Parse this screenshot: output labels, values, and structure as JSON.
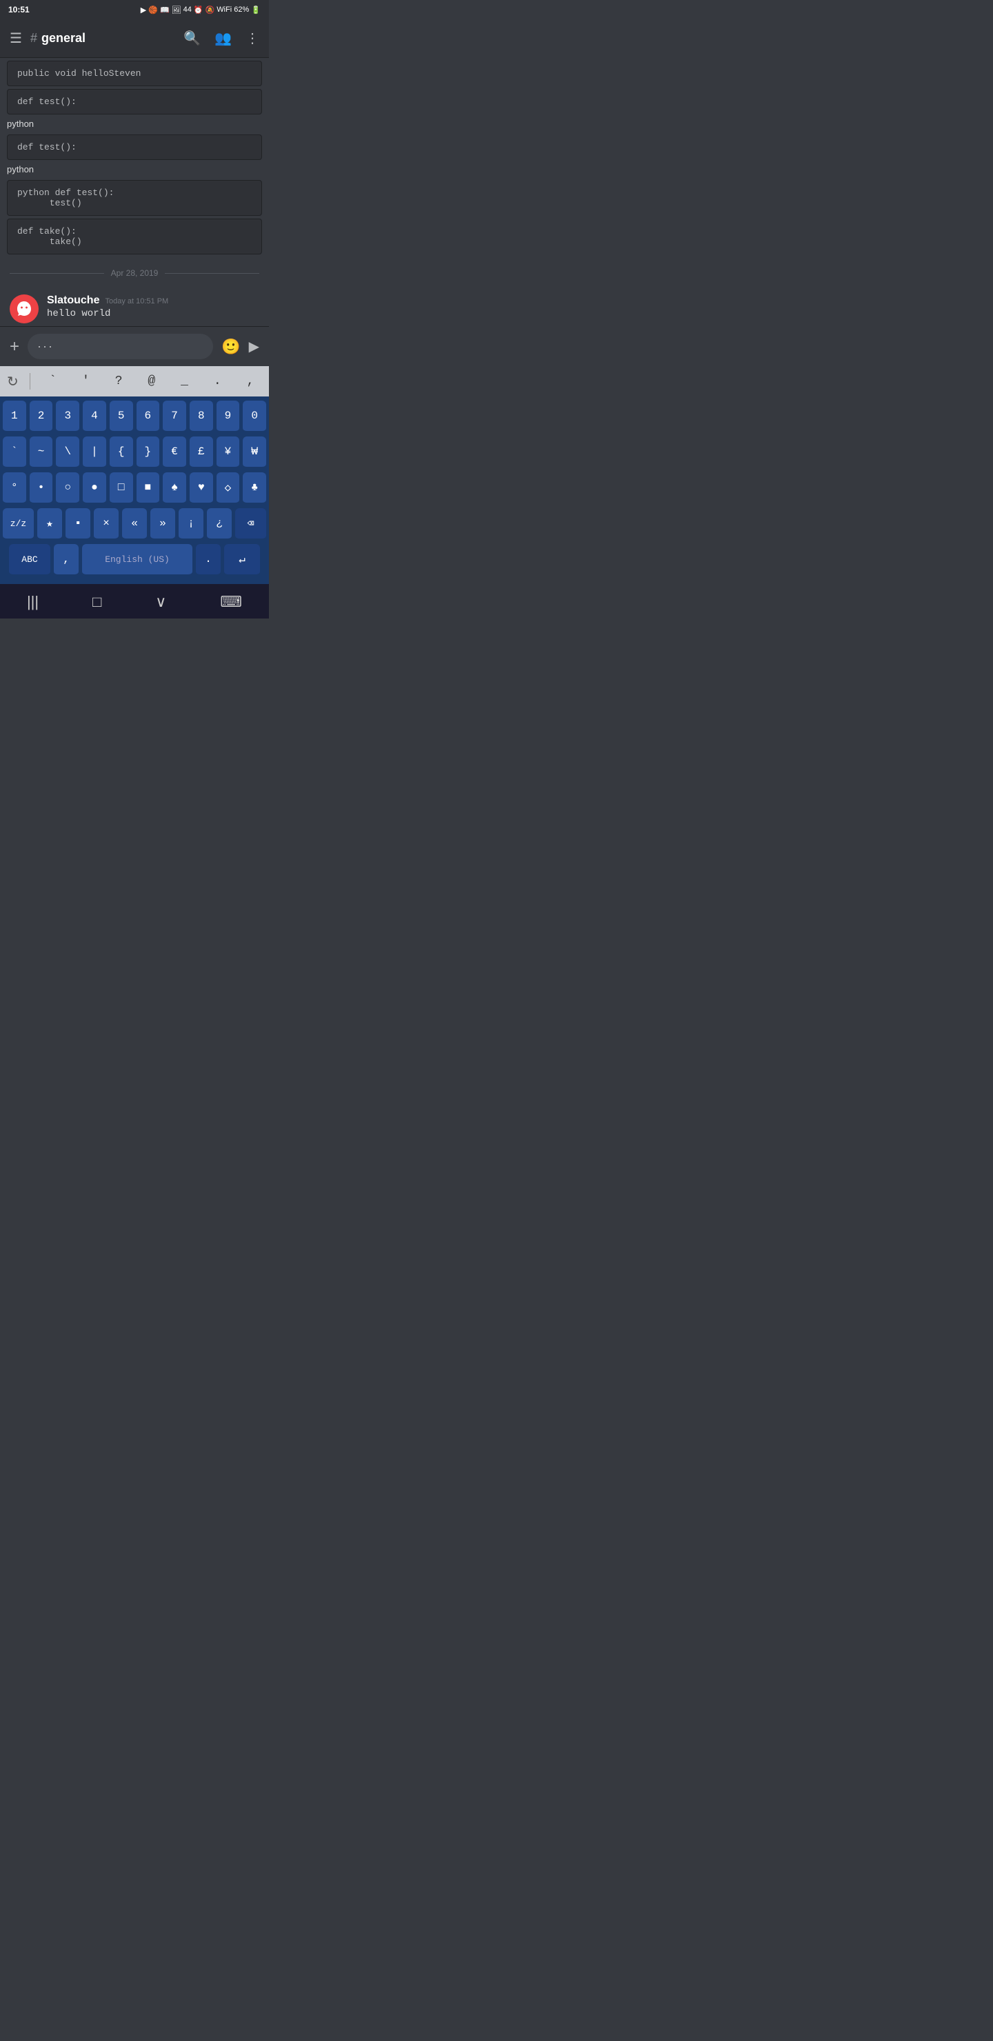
{
  "statusBar": {
    "time": "10:51",
    "battery": "62%",
    "signal": "44"
  },
  "header": {
    "channelName": "general",
    "hashSymbol": "#"
  },
  "codeBlocks": [
    {
      "id": 1,
      "code": "public void helloSteven"
    },
    {
      "id": 2,
      "code": "def test():"
    },
    {
      "id": 3,
      "lang": "python"
    },
    {
      "id": 4,
      "code": "def test():"
    },
    {
      "id": 5,
      "lang": "python"
    },
    {
      "id": 6,
      "code": "python def test():\n      test()"
    },
    {
      "id": 7,
      "code": "def take():\n      take()"
    }
  ],
  "dateSeparator": "Apr 28, 2019",
  "message": {
    "author": "Slatouche",
    "time": "Today at 10:51 PM",
    "text": "hello world"
  },
  "inputBar": {
    "placeholder": "···"
  },
  "toolbar": {
    "keys": [
      "`",
      "'",
      "?",
      "@",
      "_",
      ".",
      ","
    ]
  },
  "keyboard": {
    "rows": [
      [
        "1",
        "2",
        "3",
        "4",
        "5",
        "6",
        "7",
        "8",
        "9",
        "0"
      ],
      [
        "`",
        "~",
        "\\",
        "|",
        "{",
        "}",
        "€",
        "£",
        "¥",
        "₩"
      ],
      [
        "°",
        "•",
        "○",
        "●",
        "□",
        "■",
        "♠",
        "♥",
        "◇",
        "♣"
      ],
      [
        "z/z",
        "★",
        "▪",
        "×",
        "«",
        "»",
        "¡",
        "¿",
        "⌫"
      ],
      [
        "ABC",
        ",",
        "English (US)",
        ".",
        "↵"
      ]
    ]
  },
  "navBar": {
    "buttons": [
      "|||",
      "□",
      "∨",
      "⌨"
    ]
  }
}
